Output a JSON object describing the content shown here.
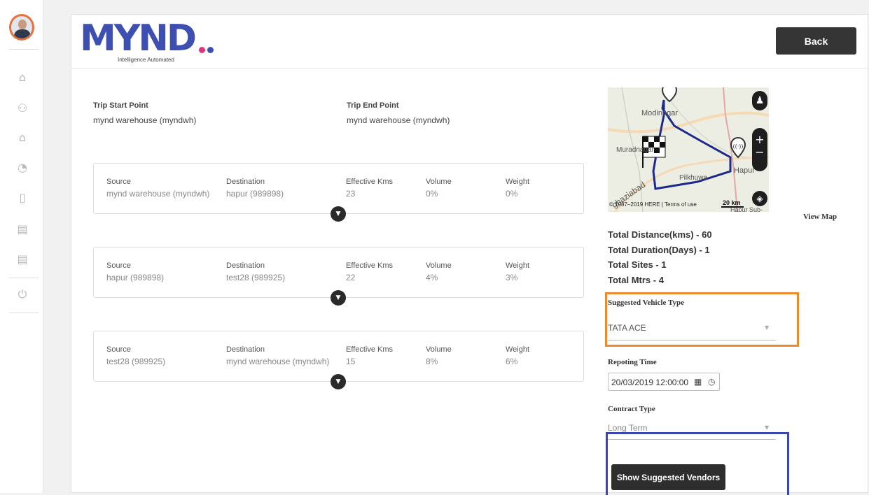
{
  "colors": {
    "brand": "#3d4fb0",
    "dot_pink": "#e0377c",
    "dot_blue": "#3d4fb0",
    "highlight_orange": "#ef8a2c",
    "highlight_blue": "#3b44b8",
    "button_dark": "#353535"
  },
  "sidebar": {
    "icons": [
      "home-icon",
      "org-chart-icon",
      "home-icon",
      "history-icon",
      "document-icon",
      "card-icon",
      "card-icon",
      "power-icon"
    ]
  },
  "header": {
    "logo_text": "MYND",
    "logo_tagline": "Intelligence Automated",
    "back_label": "Back"
  },
  "trip": {
    "start_label": "Trip Start Point",
    "start_value": "mynd warehouse (myndwh)",
    "end_label": "Trip End Point",
    "end_value": "mynd warehouse (myndwh)"
  },
  "legs": [
    {
      "source_label": "Source",
      "source": "mynd warehouse (myndwh)",
      "dest_label": "Destination",
      "dest": "hapur (989898)",
      "kms_label": "Effective Kms",
      "kms": "23",
      "vol_label": "Volume",
      "vol": "0%",
      "wt_label": "Weight",
      "wt": "0%"
    },
    {
      "source_label": "Source",
      "source": "hapur (989898)",
      "dest_label": "Destination",
      "dest": "test28 (989925)",
      "kms_label": "Effective Kms",
      "kms": "22",
      "vol_label": "Volume",
      "vol": "4%",
      "wt_label": "Weight",
      "wt": "3%"
    },
    {
      "source_label": "Source",
      "source": "test28 (989925)",
      "dest_label": "Destination",
      "dest": "mynd warehouse (myndwh)",
      "kms_label": "Effective Kms",
      "kms": "15",
      "vol_label": "Volume",
      "vol": "8%",
      "wt_label": "Weight",
      "wt": "6%"
    }
  ],
  "map": {
    "labels": [
      "Modinagar",
      "Muradnagar",
      "Pilkhuwa",
      "Hapur",
      "Hapur Sub-",
      "ghaziabad"
    ],
    "copyright": "© 1987–2019 HERE",
    "terms": "Terms of use",
    "scale": "20 km",
    "view_map_label": "View Map"
  },
  "stats": {
    "distance": "Total Distance(kms) - 60",
    "duration": "Total Duration(Days) - 1",
    "sites": "Total Sites - 1",
    "mtrs": "Total Mtrs - 4"
  },
  "form": {
    "vehicle_label": "Suggested Vehicle Type",
    "vehicle_value": "TATA ACE",
    "reporting_label": "Repoting Time",
    "reporting_value": "20/03/2019 12:00:00",
    "contract_label": "Contract Type",
    "contract_value": "Long Term",
    "vendors_button": "Show Suggested Vendors"
  }
}
